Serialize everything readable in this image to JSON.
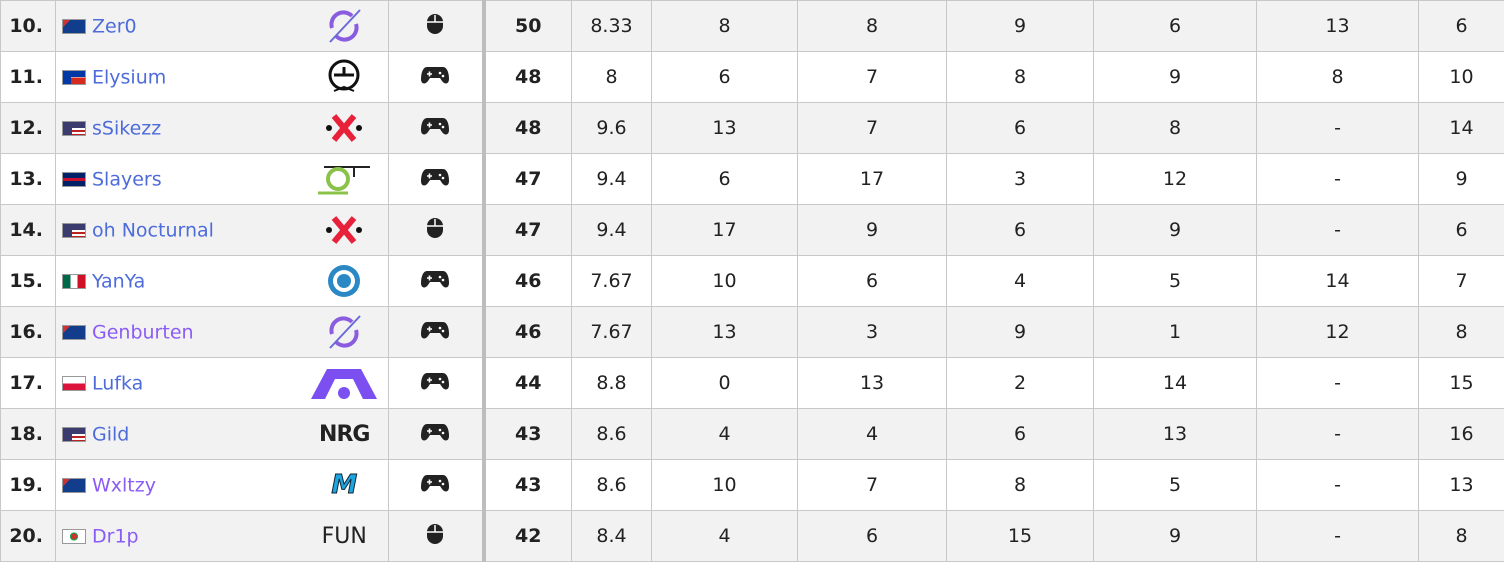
{
  "rows": [
    {
      "rank": "10.",
      "country": "AU",
      "player": "Zer0",
      "visited": false,
      "team_icon": "dark-zero-logo",
      "input": "mouse",
      "points": "50",
      "avg": "8.33",
      "games": [
        "8",
        "8",
        "9",
        "6",
        "13",
        "6"
      ]
    },
    {
      "rank": "11.",
      "country": "CL",
      "player": "Elysium",
      "visited": false,
      "team_icon": "shopify-rebellion-logo",
      "input": "controller",
      "points": "48",
      "avg": "8",
      "games": [
        "6",
        "7",
        "8",
        "9",
        "8",
        "10"
      ]
    },
    {
      "rank": "12.",
      "country": "US",
      "player": "sSikezz",
      "visited": false,
      "team_icon": "xset-logo",
      "input": "controller",
      "points": "48",
      "avg": "9.6",
      "games": [
        "13",
        "7",
        "6",
        "8",
        "-",
        "14"
      ]
    },
    {
      "rank": "13.",
      "country": "GB",
      "player": "Slayers",
      "visited": false,
      "team_icon": "optic-logo",
      "input": "controller",
      "points": "47",
      "avg": "9.4",
      "games": [
        "6",
        "17",
        "3",
        "12",
        "-",
        "9"
      ]
    },
    {
      "rank": "14.",
      "country": "US",
      "player": "oh Nocturnal",
      "visited": false,
      "team_icon": "xset-logo",
      "input": "mouse",
      "points": "47",
      "avg": "9.4",
      "games": [
        "17",
        "9",
        "6",
        "9",
        "-",
        "6"
      ]
    },
    {
      "rank": "15.",
      "country": "MX",
      "player": "YanYa",
      "visited": false,
      "team_icon": "luminosity-logo",
      "input": "controller",
      "points": "46",
      "avg": "7.67",
      "games": [
        "10",
        "6",
        "4",
        "5",
        "14",
        "7"
      ]
    },
    {
      "rank": "16.",
      "country": "AU",
      "player": "Genburten",
      "visited": true,
      "team_icon": "dark-zero-logo",
      "input": "controller",
      "points": "46",
      "avg": "7.67",
      "games": [
        "13",
        "3",
        "9",
        "1",
        "12",
        "8"
      ]
    },
    {
      "rank": "17.",
      "country": "PL",
      "player": "Lufka",
      "visited": false,
      "team_icon": "alliance-logo",
      "input": "controller",
      "points": "44",
      "avg": "8.8",
      "games": [
        "0",
        "13",
        "2",
        "14",
        "-",
        "15"
      ]
    },
    {
      "rank": "18.",
      "country": "US",
      "player": "Gild",
      "visited": false,
      "team_icon": "nrg-logo",
      "input": "controller",
      "points": "43",
      "avg": "8.6",
      "games": [
        "4",
        "4",
        "6",
        "13",
        "-",
        "16"
      ]
    },
    {
      "rank": "19.",
      "country": "AU",
      "player": "Wxltzy",
      "visited": true,
      "team_icon": "moist-logo",
      "input": "controller",
      "points": "43",
      "avg": "8.6",
      "games": [
        "10",
        "7",
        "8",
        "5",
        "-",
        "13"
      ]
    },
    {
      "rank": "20.",
      "country": "KR",
      "player": "Dr1p",
      "visited": true,
      "team_icon": "fun-logo",
      "input": "mouse",
      "points": "42",
      "avg": "8.4",
      "games": [
        "4",
        "6",
        "15",
        "9",
        "-",
        "8"
      ]
    }
  ],
  "logo_text": {
    "nrg-logo": "NRG",
    "fun-logo": "FUN",
    "moist-logo": "M"
  },
  "colors": {
    "link": "#4d6bdb",
    "visited": "#8a5cf5"
  }
}
